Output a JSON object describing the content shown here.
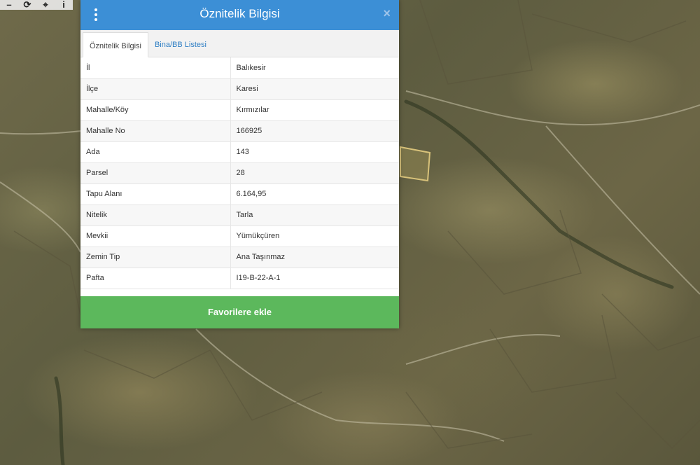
{
  "toolbar": {
    "tools": [
      {
        "icon": "minus-icon",
        "glyph": "–"
      },
      {
        "icon": "refresh-icon",
        "glyph": "⟳"
      },
      {
        "icon": "crosshair-icon",
        "glyph": "⌖"
      },
      {
        "icon": "info-icon",
        "glyph": "i"
      }
    ]
  },
  "dialog": {
    "title": "Öznitelik Bilgisi",
    "menu_icon": "vertical-ellipsis-icon",
    "close_glyph": "×",
    "header_color": "#3c8fd6",
    "tabs": [
      {
        "label": "Öznitelik Bilgisi",
        "active": true
      },
      {
        "label": "Bina/BB Listesi",
        "active": false
      }
    ],
    "rows": [
      {
        "key": "İl",
        "value": "Balıkesir"
      },
      {
        "key": "İlçe",
        "value": "Karesi"
      },
      {
        "key": "Mahalle/Köy",
        "value": "Kırmızılar"
      },
      {
        "key": "Mahalle No",
        "value": "166925"
      },
      {
        "key": "Ada",
        "value": "143"
      },
      {
        "key": "Parsel",
        "value": "28"
      },
      {
        "key": "Tapu Alanı",
        "value": "6.164,95"
      },
      {
        "key": "Nitelik",
        "value": "Tarla"
      },
      {
        "key": "Mevkii",
        "value": "Yümükçüren"
      },
      {
        "key": "Zemin Tip",
        "value": "Ana Taşınmaz"
      },
      {
        "key": "Pafta",
        "value": "I19-B-22-A-1"
      }
    ],
    "favorite_button": "Favorilere ekle",
    "favorite_color": "#5cb85c"
  }
}
